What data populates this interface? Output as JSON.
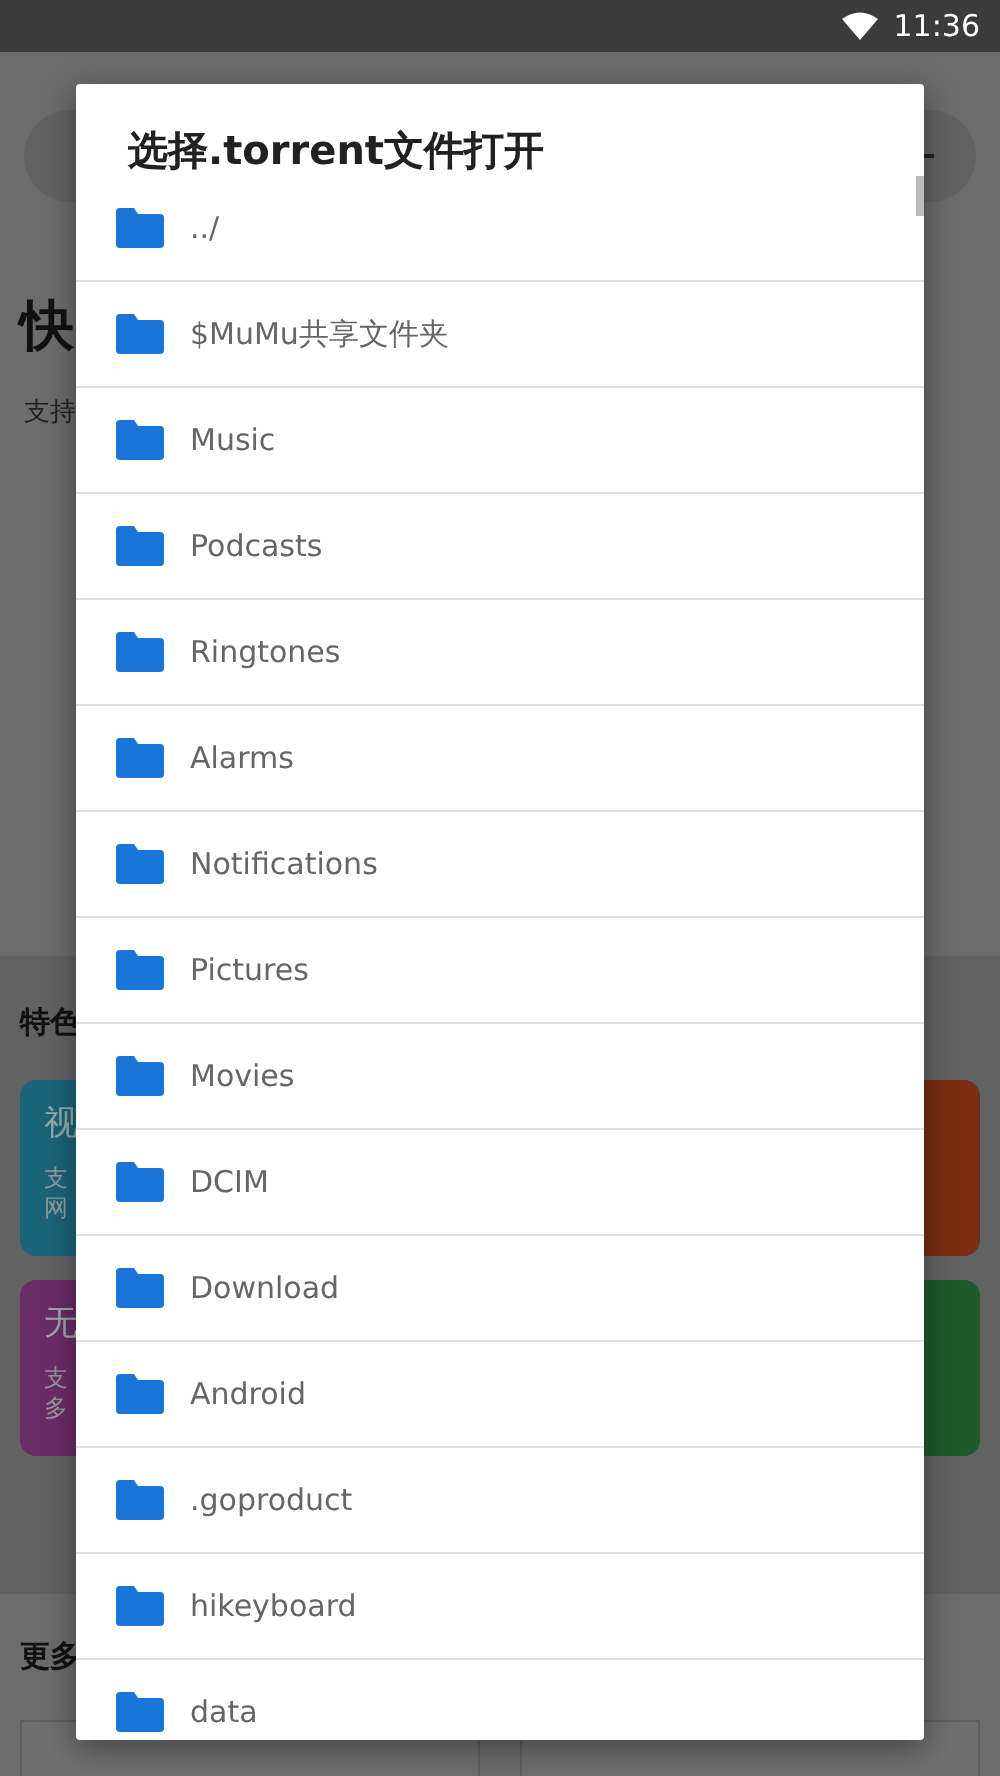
{
  "status_bar": {
    "time": "11:36"
  },
  "background": {
    "title": "快",
    "subtitle": "支持",
    "features": {
      "heading": "特色",
      "cards": [
        {
          "title": "视",
          "lines": [
            "支",
            "网"
          ],
          "color": "#1a6479"
        },
        {
          "color": "#7a2e12"
        },
        {
          "title": "无",
          "lines": [
            "支",
            "多"
          ],
          "color": "#6a2c68"
        },
        {
          "color": "#1e5a2c"
        }
      ]
    },
    "more": {
      "heading": "更多"
    }
  },
  "dialog": {
    "title": "选择.torrent文件打开",
    "items": [
      "../",
      "$MuMu共享文件夹",
      "Music",
      "Podcasts",
      "Ringtones",
      "Alarms",
      "Notifications",
      "Pictures",
      "Movies",
      "DCIM",
      "Download",
      "Android",
      ".goproduct",
      "hikeyboard",
      "data"
    ]
  }
}
